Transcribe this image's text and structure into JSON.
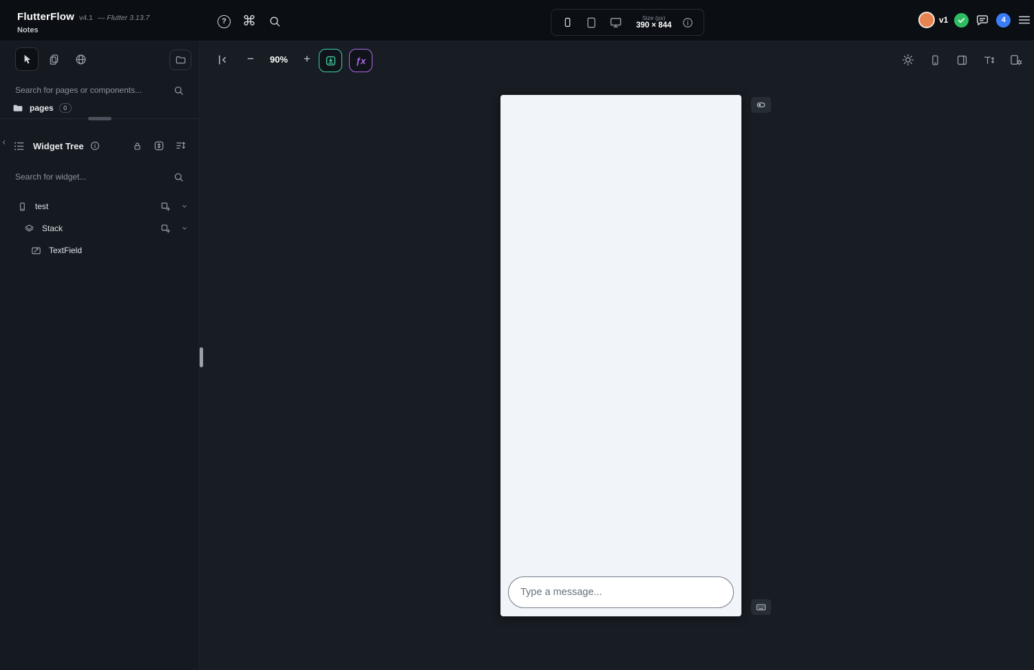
{
  "topbar": {
    "brand": "FlutterFlow",
    "version": "v4.1",
    "flutter_version": "— Flutter 3.13.7",
    "project_name": "Notes",
    "device_size": {
      "label": "Size (px)",
      "value": "390 × 844"
    },
    "branch_label": "v1",
    "notification_count": "4"
  },
  "icons": {
    "command_glyph": "⌘",
    "question_glyph": "?",
    "minus_glyph": "−",
    "plus_glyph": "+",
    "fx_glyph": "ƒx"
  },
  "sidebar": {
    "pages_search_placeholder": "Search for pages or components...",
    "pages_folder": {
      "label": "pages",
      "count": "0"
    },
    "widget_tree": {
      "title": "Widget Tree",
      "search_placeholder": "Search for widget...",
      "nodes": [
        {
          "label": "test"
        },
        {
          "label": "Stack"
        },
        {
          "label": "TextField"
        }
      ]
    }
  },
  "canvas_toolbar": {
    "zoom_level": "90%"
  },
  "canvas": {
    "textfield_placeholder": "Type a message..."
  },
  "colors": {
    "accent_green": "#3fd0a6",
    "accent_purple": "#b06ae8",
    "badge_blue": "#3b7df6",
    "avatar_orange": "#e8824f",
    "check_green": "#2fbd62",
    "canvas_bg": "#f1f4f8"
  }
}
